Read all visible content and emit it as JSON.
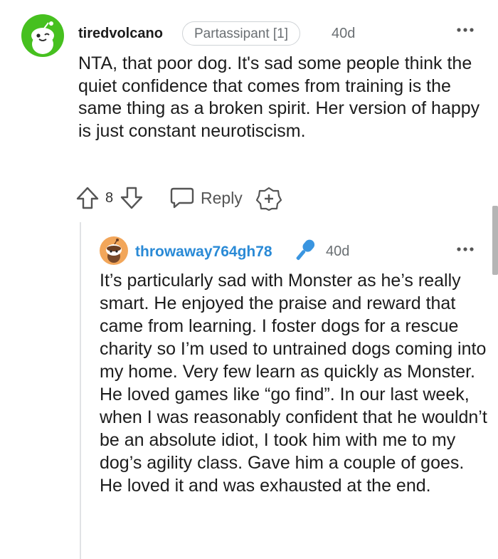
{
  "comment": {
    "author": "tiredvolcano",
    "flair": "Partassipant [1]",
    "age": "40d",
    "body": "NTA, that poor dog. It's sad some people think the quiet confidence that comes from training is the same thing as a broken spirit. Her version of happy is just constant neurotiscism.",
    "vote_count": "8",
    "reply_label": "Reply"
  },
  "reply": {
    "author": "throwaway764gh78",
    "age": "40d",
    "body": "It’s particularly sad with Monster as he’s really smart. He enjoyed the praise and reward that came from learning. I foster dogs for a rescue charity so I’m used to untrained dogs coming into my home. Very few learn as quickly as Monster. He loved games like “go find”. In our last week, when I was reasonably confident that he wouldn’t be an absolute idiot, I took him with me to my dog’s agility class. Gave him a couple of goes. He loved it and was exhausted at the end."
  },
  "icons": {
    "avatar1": "snoo-avatar-icon",
    "avatar2": "snoo-avatar-icon",
    "more": "more-options-icon",
    "upvote": "upvote-arrow-icon",
    "downvote": "downvote-arrow-icon",
    "reply": "speech-bubble-icon",
    "award": "award-plus-icon",
    "op_badge": "microphone-icon"
  },
  "colors": {
    "avatar1_bg": "#46c01f",
    "avatar2_bg": "#f2a65a",
    "op_username": "#2a8ad6",
    "op_mic": "#3a95e0",
    "meta_text": "#6a6f73"
  }
}
